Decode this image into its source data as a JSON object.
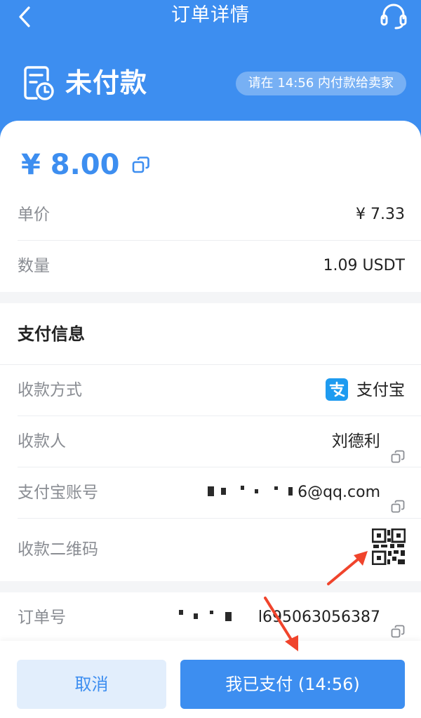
{
  "nav": {
    "title": "订单详情",
    "back_icon": "chevron-left-icon",
    "support_icon": "headset-icon"
  },
  "status": {
    "icon": "order-clock-icon",
    "text": "未付款",
    "deadline": "请在 14:56 内付款给卖家"
  },
  "order": {
    "amount": "¥ 8.00",
    "unit_price_label": "单价",
    "unit_price_value": "¥ 7.33",
    "quantity_label": "数量",
    "quantity_value": "1.09 USDT"
  },
  "payment": {
    "section_title": "支付信息",
    "method_label": "收款方式",
    "method_value": "支付宝",
    "payee_label": "收款人",
    "payee_value": "刘德利",
    "account_label": "支付宝账号",
    "account_value": "6@qq.com",
    "qr_label": "收款二维码"
  },
  "order_info": {
    "order_no_label": "订单号",
    "order_no_value": "l695063056387"
  },
  "actions": {
    "cancel_label": "取消",
    "paid_label": "我已支付 (14:56)"
  },
  "colors": {
    "primary": "#3d8ef0",
    "alipay": "#1e9bf0",
    "annotation_arrow": "#f0442c"
  }
}
